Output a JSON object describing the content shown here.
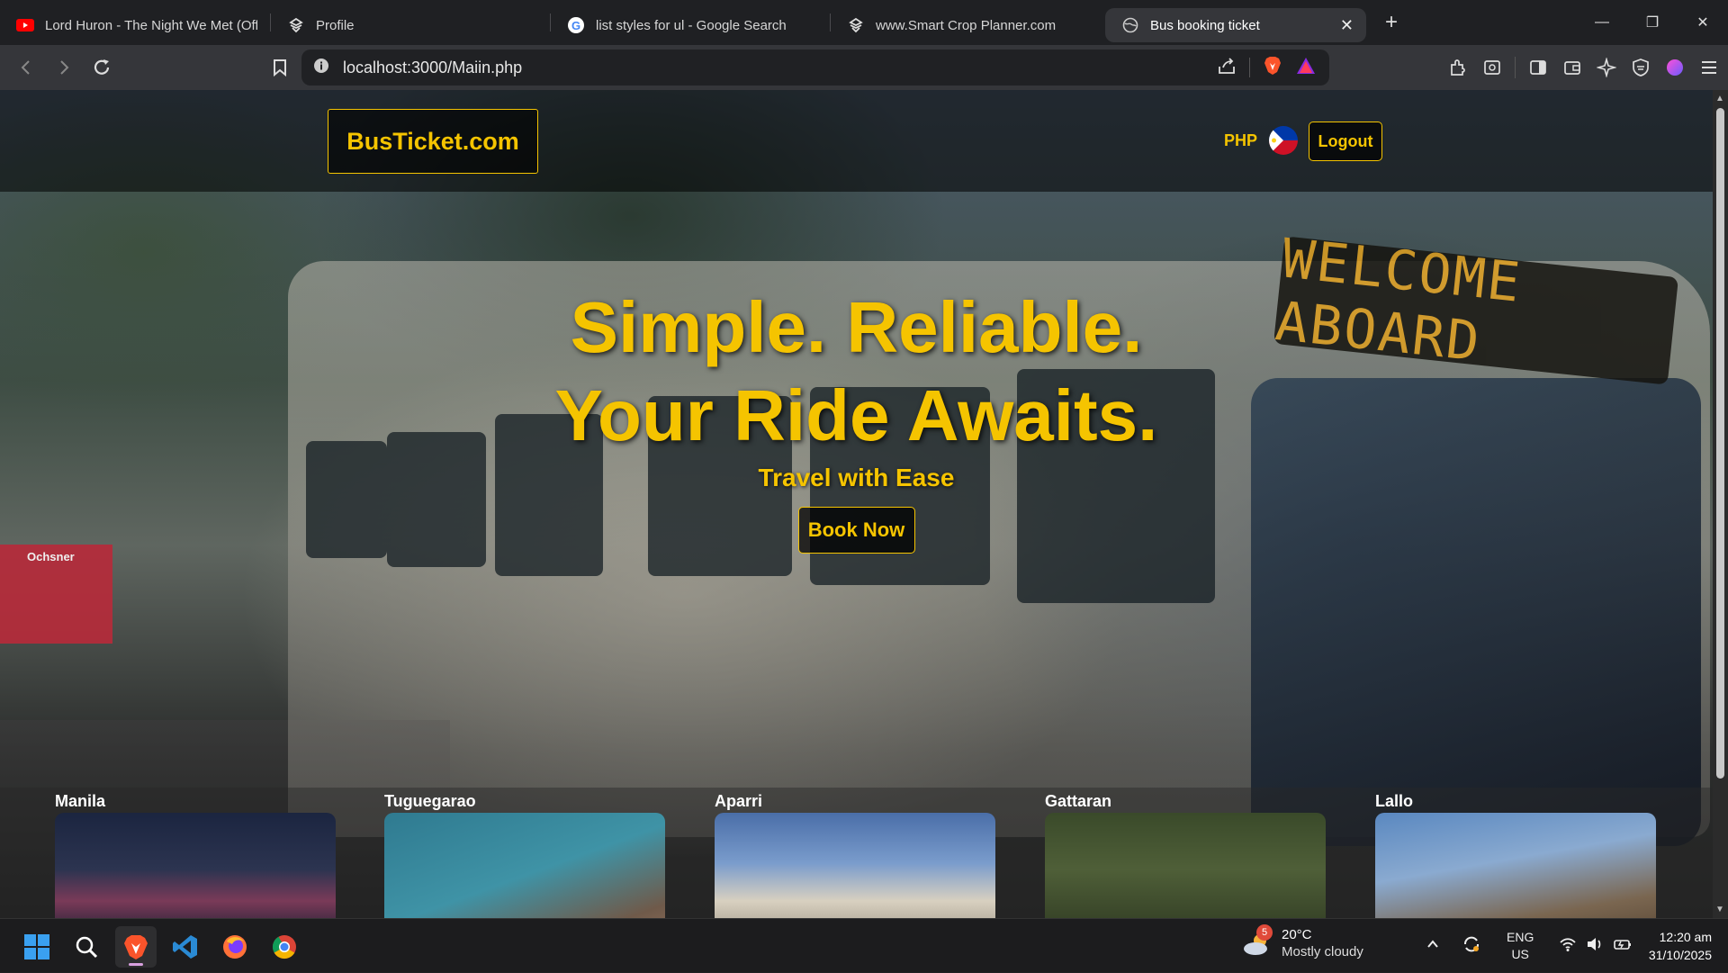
{
  "browser": {
    "tabs": [
      {
        "title": "Lord Huron - The Night We Met (Offi",
        "icon": "youtube-icon",
        "active": false
      },
      {
        "title": "Profile",
        "icon": "brave-glyph-icon",
        "active": false
      },
      {
        "title": "list styles for ul - Google Search",
        "icon": "google-icon",
        "active": false
      },
      {
        "title": "www.Smart Crop Planner.com",
        "icon": "brave-glyph-icon",
        "active": false
      },
      {
        "title": "Bus booking ticket",
        "icon": "globe-icon",
        "active": true
      }
    ],
    "new_tab": "+",
    "url": "localhost:3000/Maiin.php"
  },
  "site": {
    "logo": "BusTicket.com",
    "currency": "PHP",
    "logout_label": "Logout",
    "hero": {
      "line1": "Simple. Reliable.",
      "line2": "Your Ride Awaits.",
      "subtitle": "Travel with Ease",
      "cta": "Book Now"
    },
    "bus_sign": "WELCOME ABOARD",
    "street_sign": "Ochsner",
    "destinations": [
      {
        "name": "Manila"
      },
      {
        "name": "Tuguegarao"
      },
      {
        "name": "Aparri"
      },
      {
        "name": "Gattaran"
      },
      {
        "name": "Lallo"
      }
    ]
  },
  "taskbar": {
    "weather_badge": "5",
    "temperature": "20°C",
    "condition": "Mostly cloudy",
    "lang_1": "ENG",
    "lang_2": "US",
    "time": "12:20 am",
    "date": "31/10/2025"
  },
  "colors": {
    "accent": "#f5c400",
    "tab_active": "#35363a",
    "chrome_dark": "#1f2023"
  }
}
